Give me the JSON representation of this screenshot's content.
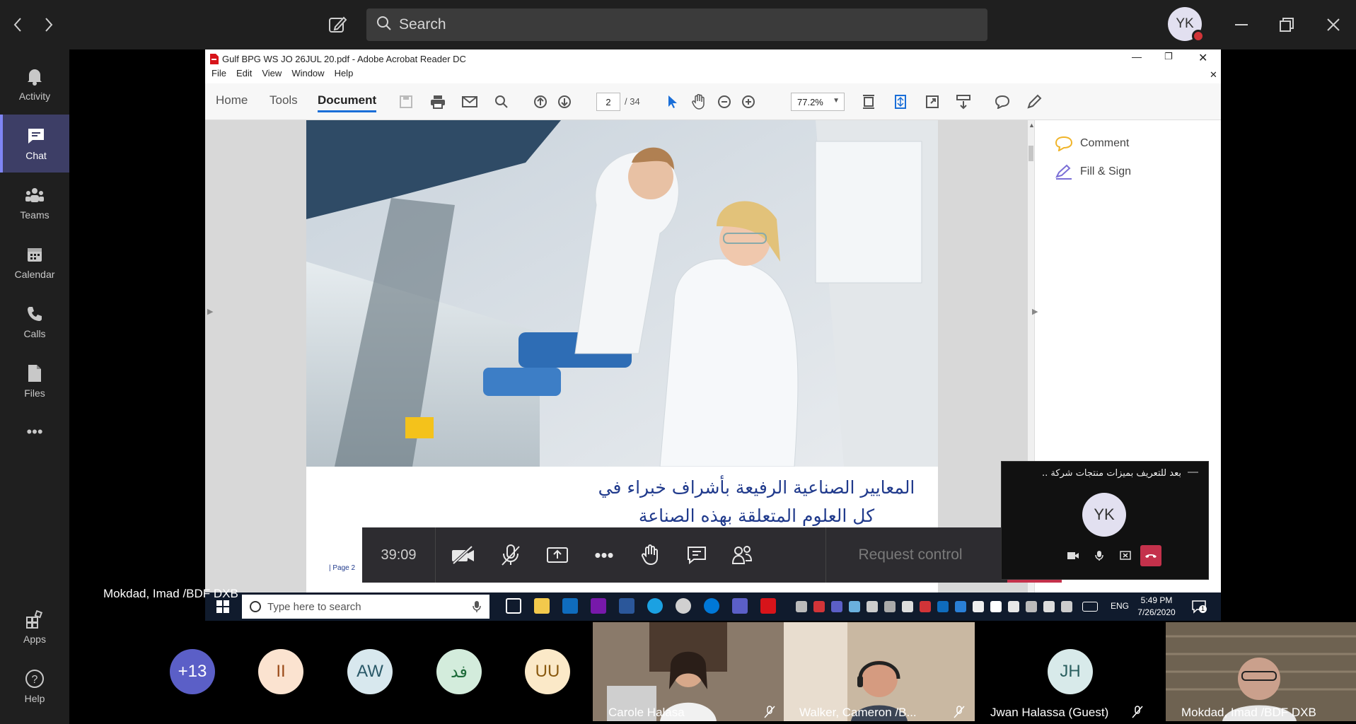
{
  "teams": {
    "search_placeholder": "Search",
    "user_initials": "YK",
    "rail": [
      {
        "label": "Activity",
        "icon": "bell-icon"
      },
      {
        "label": "Chat",
        "icon": "chat-icon"
      },
      {
        "label": "Teams",
        "icon": "teams-icon"
      },
      {
        "label": "Calendar",
        "icon": "calendar-icon"
      },
      {
        "label": "Calls",
        "icon": "phone-icon"
      },
      {
        "label": "Files",
        "icon": "file-icon"
      },
      {
        "label": "•••",
        "icon": "more-icon"
      },
      {
        "label": "Apps",
        "icon": "apps-icon"
      },
      {
        "label": "Help",
        "icon": "help-icon"
      }
    ],
    "accent": "#7f85f5",
    "hangup_color": "#c4314b"
  },
  "acrobat": {
    "window_title": "Gulf BPG WS JO 26JUL 20.pdf - Adobe Acrobat Reader DC",
    "menu": [
      "File",
      "Edit",
      "View",
      "Window",
      "Help"
    ],
    "tabs": [
      "Home",
      "Tools",
      "Document"
    ],
    "active_tab": "Document",
    "page_current": "2",
    "page_total": "/ 34",
    "zoom": "77.2%",
    "right_panel": [
      "Comment",
      "Fill & Sign"
    ],
    "arabic_line1": "المعايير الصناعية الرفيعة بأشراف خبراء في",
    "arabic_line2": "كل العلوم المتعلقة بهذه الصناعة",
    "page_footer": "| Page 2"
  },
  "call": {
    "timer": "39:09",
    "request_control": "Request control",
    "sharer_name": "Mokdad, Imad /BDF DXB",
    "mini_title": "بعد للتعريف بميزات منتجات شركة ..",
    "mini_initials": "YK"
  },
  "taskbar": {
    "search_placeholder": "Type here to search",
    "lang": "ENG",
    "time": "5:49 PM",
    "date": "7/26/2020",
    "notification_count": "1"
  },
  "participants": [
    {
      "initials": "+13",
      "color": "#5b5fc7",
      "text_color": "#ffffff"
    },
    {
      "initials": "II",
      "color": "#fbe3d0",
      "text_color": "#9a4a18"
    },
    {
      "initials": "AW",
      "color": "#d8e8ee",
      "text_color": "#2a5968"
    },
    {
      "initials": "فد",
      "color": "#d3ecdc",
      "text_color": "#1e6b3a"
    },
    {
      "initials": "UU",
      "color": "#fbe9c8",
      "text_color": "#8a5a10"
    },
    {
      "name": "Carole Halasa"
    },
    {
      "name": "Walker, Cameron /B..."
    },
    {
      "initials": "JH",
      "name": "Jwan Halassa (Guest)",
      "color": "#d8eaea",
      "text_color": "#2a5f5f"
    },
    {
      "name": "Mokdad, Imad /BDF DXB"
    }
  ]
}
